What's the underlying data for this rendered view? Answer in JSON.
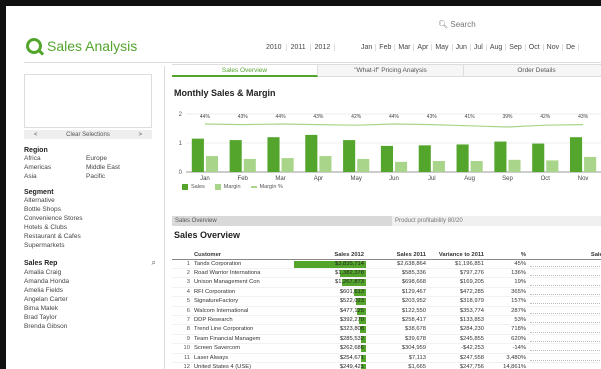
{
  "search_label": "Search",
  "app_title": "Sales Analysis",
  "years": [
    "2010",
    "2011",
    "2012"
  ],
  "months": [
    "Jan",
    "Feb",
    "Mar",
    "Apr",
    "May",
    "Jun",
    "Jul",
    "Aug",
    "Sep",
    "Oct",
    "Nov",
    "De"
  ],
  "sidebar": {
    "clear_label": "Clear Selections",
    "prev": "<",
    "next": ">",
    "region_title": "Region",
    "regions": [
      "Africa",
      "Europe",
      "Americas",
      "Middle East",
      "Asia",
      "Pacific"
    ],
    "segment_title": "Segment",
    "segments": [
      "Alternative",
      "Bottle Shops",
      "Convenience Stores",
      "Hotels & Clubs",
      "Restaurant & Cafes",
      "Supermarkets"
    ],
    "salesrep_title": "Sales Rep",
    "salesreps": [
      "Amalia Craig",
      "Amanda Honda",
      "Amelia Fields",
      "Angelan Carter",
      "Bima Malek",
      "Brad Taylor",
      "Brenda Gibson"
    ]
  },
  "tabs": [
    "Sales Overview",
    "\"What-if\" Pricing Analysis",
    "Order Details"
  ],
  "chart_title": "Monthly Sales & Margin",
  "legend": [
    "Sales",
    "Margin",
    "Margin %"
  ],
  "colors": {
    "accent": "#54a52c",
    "sales": "#54a52c",
    "margin": "#a9d58a",
    "line": "#a9d58a"
  },
  "chart_data": {
    "type": "bar",
    "categories": [
      "Jan",
      "Feb",
      "Mar",
      "Apr",
      "May",
      "Jun",
      "Jul",
      "Aug",
      "Sep",
      "Oct",
      "Nov"
    ],
    "series": [
      {
        "name": "Sales",
        "values": [
          1.15,
          1.1,
          1.2,
          1.28,
          1.1,
          0.9,
          0.92,
          0.95,
          1.05,
          0.98,
          1.2
        ]
      },
      {
        "name": "Margin",
        "values": [
          0.55,
          0.45,
          0.48,
          0.55,
          0.45,
          0.35,
          0.38,
          0.38,
          0.42,
          0.4,
          0.52
        ]
      },
      {
        "name": "Margin %",
        "values": [
          44,
          43,
          44,
          43,
          42,
          44,
          43,
          41,
          39,
          42,
          43
        ]
      }
    ],
    "data_labels": [
      "44%",
      "43%",
      "44%",
      "43%",
      "42%",
      "44%",
      "43%",
      "41%",
      "39%",
      "42%",
      "43%"
    ],
    "y_ticks": [
      "0",
      "1",
      "2"
    ],
    "ylim": [
      0,
      2
    ]
  },
  "subtabs": [
    "Sales Overview",
    "Product profitability 80/20"
  ],
  "table_title": "Sales Overview",
  "table": {
    "headers": [
      "Customer",
      "Sales 2012",
      "Sales 2011",
      "Variance to 2011",
      "%",
      "Sales"
    ],
    "rows": [
      {
        "n": "1",
        "customer": "Tands Corporation",
        "s12": "$3,835,714",
        "s11": "$2,638,864",
        "var": "$1,196,851",
        "pct": "45%",
        "bar": 1.0
      },
      {
        "n": "2",
        "customer": "Road Warrior Internationa",
        "s12": "$1,382,378",
        "s11": "$585,336",
        "var": "$797,276",
        "pct": "136%",
        "bar": 0.36
      },
      {
        "n": "3",
        "customer": "Unison Management Con",
        "s12": "$1,267,873",
        "s11": "$698,668",
        "var": "$169,205",
        "pct": "19%",
        "bar": 0.33
      },
      {
        "n": "4",
        "customer": "RFI Corporation",
        "s12": "$601,613",
        "s11": "$129,467",
        "var": "$472,285",
        "pct": "365%",
        "bar": 0.16
      },
      {
        "n": "5",
        "customer": "SignatureFactory",
        "s12": "$522,023",
        "s11": "$203,952",
        "var": "$318,979",
        "pct": "157%",
        "bar": 0.14
      },
      {
        "n": "6",
        "customer": "Walcom International",
        "s12": "$477,125",
        "s11": "$122,550",
        "var": "$353,774",
        "pct": "287%",
        "bar": 0.12
      },
      {
        "n": "7",
        "customer": "DDP Research",
        "s12": "$392,270",
        "s11": "$258,417",
        "var": "$133,853",
        "pct": "53%",
        "bar": 0.1
      },
      {
        "n": "8",
        "customer": "Trend Line Corporation",
        "s12": "$323,808",
        "s11": "$38,678",
        "var": "$284,230",
        "pct": "718%",
        "bar": 0.085
      },
      {
        "n": "9",
        "customer": "Team Financial Managem",
        "s12": "$285,532",
        "s11": "$39,678",
        "var": "$245,855",
        "pct": "620%",
        "bar": 0.075
      },
      {
        "n": "10",
        "customer": "Screen Savercom",
        "s12": "$262,686",
        "s11": "$304,959",
        "var": "-$42,253",
        "pct": "-14%",
        "bar": 0.07
      },
      {
        "n": "11",
        "customer": "Laser Always",
        "s12": "$254,671",
        "s11": "$7,113",
        "var": "$247,558",
        "pct": "3,480%",
        "bar": 0.066
      },
      {
        "n": "12",
        "customer": "United States 4 (USE)",
        "s12": "$249,421",
        "s11": "$1,665",
        "var": "$247,756",
        "pct": "14,861%",
        "bar": 0.065
      }
    ]
  }
}
